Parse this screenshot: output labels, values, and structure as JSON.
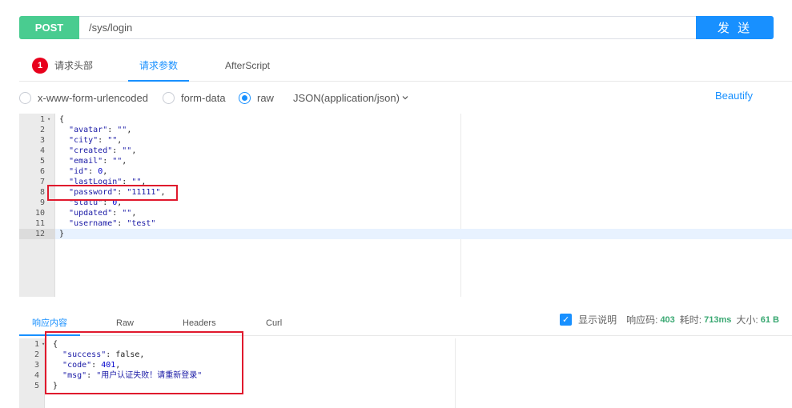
{
  "request": {
    "method": "POST",
    "url": "/sys/login",
    "send_label": "发 送"
  },
  "req_tabs": [
    {
      "badge": "1",
      "label": "请求头部"
    },
    {
      "label": "请求参数"
    },
    {
      "label": "AfterScript"
    }
  ],
  "body_types": {
    "urlencoded": "x-www-form-urlencoded",
    "form_data": "form-data",
    "raw": "raw",
    "content_type": "JSON(application/json)",
    "beautify": "Beautify"
  },
  "request_body": [
    {
      "n": "1",
      "text": "{"
    },
    {
      "n": "2",
      "text": "  \"avatar\": \"\","
    },
    {
      "n": "3",
      "text": "  \"city\": \"\","
    },
    {
      "n": "4",
      "text": "  \"created\": \"\","
    },
    {
      "n": "5",
      "text": "  \"email\": \"\","
    },
    {
      "n": "6",
      "text": "  \"id\": 0,"
    },
    {
      "n": "7",
      "text": "  \"lastLogin\": \"\","
    },
    {
      "n": "8",
      "text": "  \"password\": \"11111\","
    },
    {
      "n": "9",
      "text": "  \"statu\": 0,"
    },
    {
      "n": "10",
      "text": "  \"updated\": \"\","
    },
    {
      "n": "11",
      "text": "  \"username\": \"test\""
    },
    {
      "n": "12",
      "text": "}"
    }
  ],
  "resp_tabs": [
    "响应内容",
    "Raw",
    "Headers",
    "Curl"
  ],
  "response_meta": {
    "show_desc": "显示说明",
    "code_label": "响应码:",
    "code": "403",
    "time_label": "耗时:",
    "time": "713ms",
    "size_label": "大小:",
    "size": "61 B"
  },
  "response_body": [
    {
      "n": "1",
      "text": "{"
    },
    {
      "n": "2",
      "text": "  \"success\": false,"
    },
    {
      "n": "3",
      "text": "  \"code\": 401,"
    },
    {
      "n": "4",
      "text": "  \"msg\": \"用户认证失败！请重新登录\""
    },
    {
      "n": "5",
      "text": "}"
    }
  ],
  "colors": {
    "post": "#49cc90",
    "primary": "#1890ff",
    "highlight_box": "#e0192d",
    "status_value": "#3aa872"
  }
}
